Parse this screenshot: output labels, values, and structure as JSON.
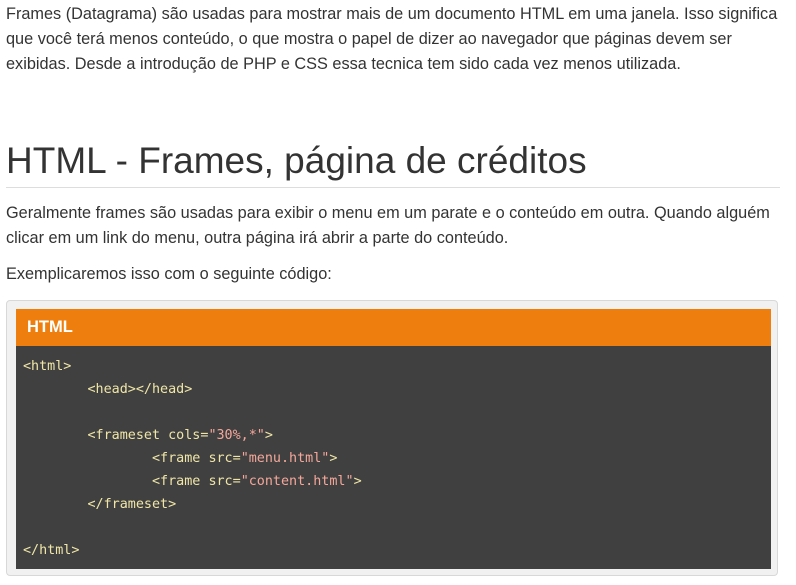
{
  "intro_paragraph": "Frames (Datagrama) são usadas para mostrar mais de um documento HTML em uma janela. Isso significa que você terá menos conteúdo, o que mostra o papel de dizer ao navegador que páginas devem ser exibidas. Desde a introdução de PHP e CSS essa tecnica tem sido cada vez menos utilizada.",
  "section_heading": "HTML - Frames, página de créditos",
  "body_paragraph": "Geralmente frames são usadas para exibir o menu em um parate e o conteúdo em outra. Quando alguém clicar em um link do menu, outra página irá abrir a parte do conteúdo.",
  "example_intro": "Exemplicaremos isso com o seguinte código:",
  "code_block": {
    "language_label": "HTML",
    "lines": {
      "l1": {
        "tag": "<html>"
      },
      "l2": {
        "indent": "        ",
        "tag": "<head></head>"
      },
      "l3": {
        "indent": ""
      },
      "l4": {
        "indent": "        ",
        "open": "<frameset ",
        "attr": "cols=",
        "value": "\"30%,*\"",
        "close": ">"
      },
      "l5": {
        "indent": "                ",
        "open": "<frame ",
        "attr": "src=",
        "value": "\"menu.html\"",
        "close": ">"
      },
      "l6": {
        "indent": "                ",
        "open": "<frame ",
        "attr": "src=",
        "value": "\"content.html\"",
        "close": ">"
      },
      "l7": {
        "indent": "        ",
        "tag": "</frameset>"
      },
      "l8": {
        "indent": ""
      },
      "l9": {
        "tag": "</html>"
      }
    }
  }
}
